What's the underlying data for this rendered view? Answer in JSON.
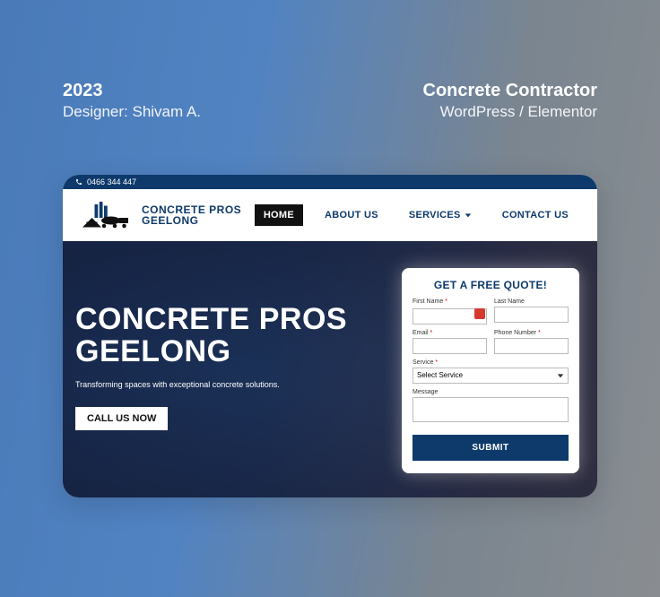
{
  "meta": {
    "year": "2023",
    "designer_label": "Designer: Shivam A.",
    "project_type": "Concrete Contractor",
    "stack": "WordPress / Elementor"
  },
  "topbar": {
    "phone": "0466 344 447"
  },
  "logo": {
    "line1": "CONCRETE PROS",
    "line2": "GEELONG"
  },
  "nav": {
    "home": "HOME",
    "about": "ABOUT US",
    "services": "SERVICES",
    "contact": "CONTACT US"
  },
  "hero": {
    "title_line1": "CONCRETE PROS",
    "title_line2": "GEELONG",
    "subtitle": "Transforming spaces with exceptional concrete solutions.",
    "cta": "CALL US NOW"
  },
  "quote": {
    "title": "GET A FREE QUOTE!",
    "labels": {
      "first_name": "First Name",
      "last_name": "Last Name",
      "email": "Email",
      "phone": "Phone Number",
      "service": "Service",
      "message": "Message"
    },
    "service_placeholder": "Select Service",
    "submit": "SUBMIT"
  }
}
